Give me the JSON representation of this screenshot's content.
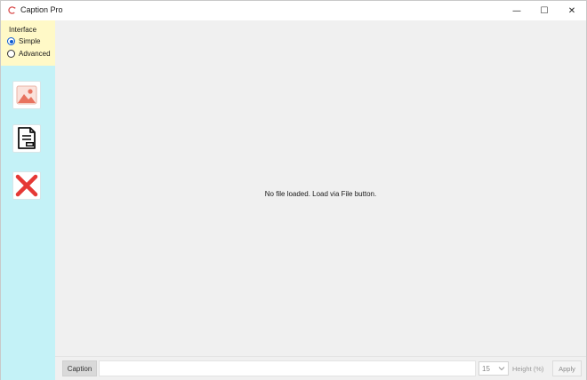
{
  "window": {
    "title": "Caption Pro",
    "controls": {
      "minimize": "—",
      "maximize": "☐",
      "close": "✕"
    }
  },
  "sidebar": {
    "interface_label": "Interface",
    "modes": [
      {
        "label": "Simple",
        "selected": true
      },
      {
        "label": "Advanced",
        "selected": false
      }
    ],
    "buttons": [
      {
        "icon": "image-icon"
      },
      {
        "icon": "document-icon"
      },
      {
        "icon": "close-x-icon"
      }
    ],
    "colors": {
      "background": "#c4f2f7",
      "interface_panel": "#fff9c7"
    }
  },
  "main": {
    "empty_message": "No file loaded. Load via File button."
  },
  "bottom_bar": {
    "caption_button": "Caption",
    "caption_value": "",
    "height_value": "15",
    "height_label": "Height (%)",
    "apply_button": "Apply"
  }
}
